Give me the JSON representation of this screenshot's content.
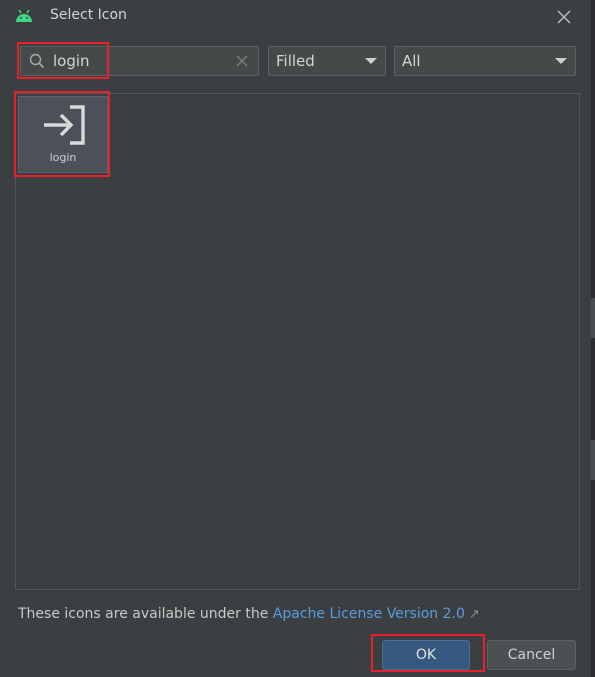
{
  "window": {
    "title": "Select Icon",
    "app_icon": "android-icon",
    "close_icon": "close-icon"
  },
  "search": {
    "value": "login",
    "placeholder": "",
    "icon": "search-icon",
    "clear_icon": "clear-icon"
  },
  "style_select": {
    "selected": "Filled"
  },
  "category_select": {
    "selected": "All"
  },
  "results": [
    {
      "label": "login",
      "icon": "login-icon"
    }
  ],
  "footer": {
    "license_prefix": "These icons are available under the ",
    "license_link": "Apache License Version 2.0",
    "link_icon": "external-link-icon"
  },
  "buttons": {
    "ok": "OK",
    "cancel": "Cancel"
  },
  "colors": {
    "background": "#3c3f41",
    "accent": "#365880",
    "link": "#5a9be0",
    "highlight": "#e8202a",
    "android": "#3ddc84"
  }
}
